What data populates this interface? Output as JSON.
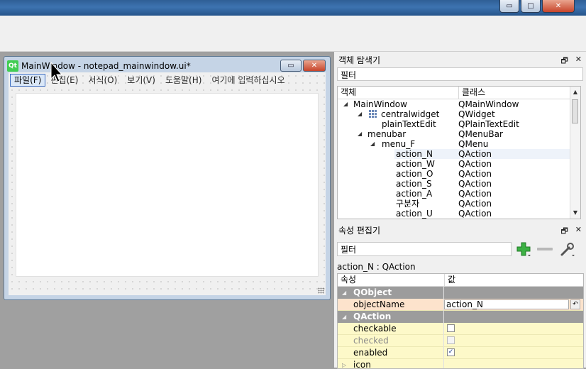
{
  "top_window": {
    "minimize": "▭",
    "maximize": "□",
    "close": "✕"
  },
  "form_window": {
    "icon_text": "Qt",
    "title": "MainWindow - notepad_mainwindow.ui*",
    "menus": [
      "파일(F)",
      "편집(E)",
      "서식(O)",
      "보기(V)",
      "도움말(H)",
      "여기에 입력하십시오"
    ],
    "minimize": "▭",
    "close": "✕"
  },
  "object_inspector": {
    "title": "객체 탐색기",
    "float_btn": "🗗",
    "close_btn": "✕",
    "filter_placeholder": "필터",
    "col_object": "객체",
    "col_class": "클래스",
    "rows": [
      {
        "name": "MainWindow",
        "class": "QMainWindow"
      },
      {
        "name": "centralwidget",
        "class": "QWidget"
      },
      {
        "name": "plainTextEdit",
        "class": "QPlainTextEdit"
      },
      {
        "name": "menubar",
        "class": "QMenuBar"
      },
      {
        "name": "menu_F",
        "class": "QMenu"
      },
      {
        "name": "action_N",
        "class": "QAction"
      },
      {
        "name": "action_W",
        "class": "QAction"
      },
      {
        "name": "action_O",
        "class": "QAction"
      },
      {
        "name": "action_S",
        "class": "QAction"
      },
      {
        "name": "action_A",
        "class": "QAction"
      },
      {
        "name": "구분자",
        "class": "QAction"
      },
      {
        "name": "action_U",
        "class": "QAction"
      }
    ]
  },
  "property_editor": {
    "title": "속성 편집기",
    "float_btn": "🗗",
    "close_btn": "✕",
    "filter_placeholder": "필터",
    "object_label": "action_N : QAction",
    "col_property": "속성",
    "col_value": "값",
    "groups": [
      "QObject",
      "QAction"
    ],
    "object_name_label": "objectName",
    "object_name_value": "action_N",
    "checkable_label": "checkable",
    "checked_label": "checked",
    "enabled_label": "enabled",
    "icon_label": "icon",
    "enabled_check": "✓"
  }
}
